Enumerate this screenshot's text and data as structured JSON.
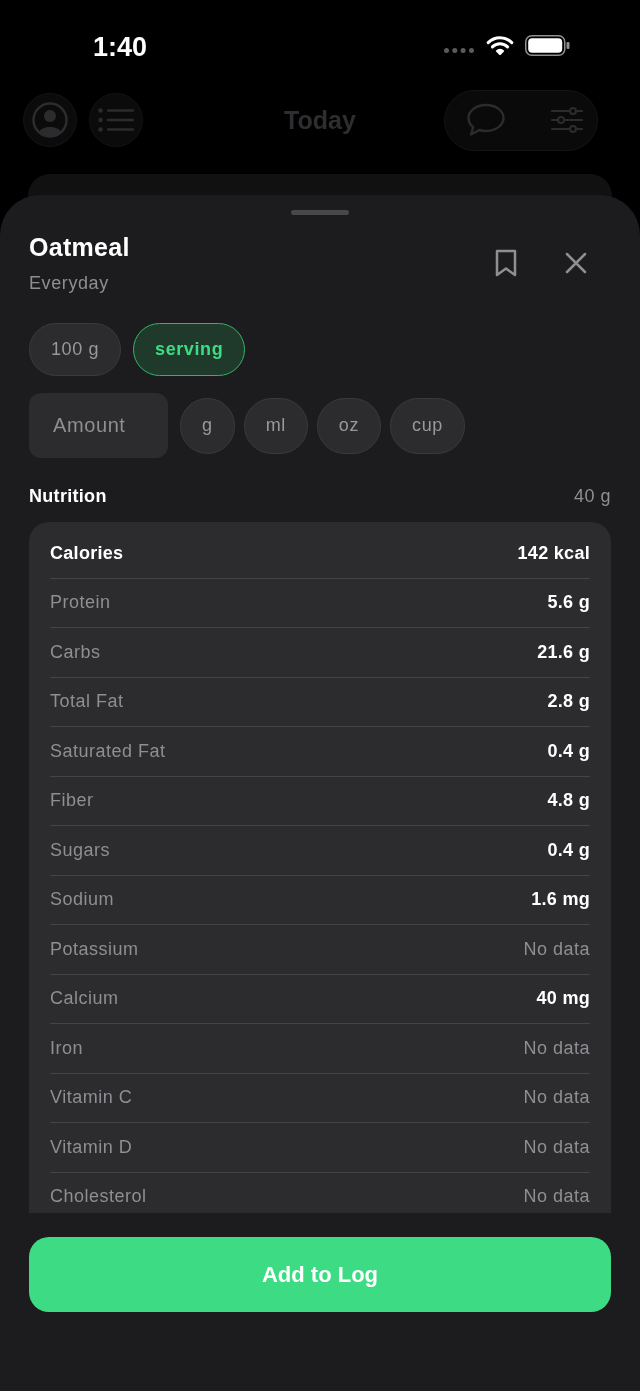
{
  "status_bar": {
    "time": "1:40"
  },
  "header": {
    "title": "Today"
  },
  "food": {
    "name": "Oatmeal",
    "brand": "Everyday"
  },
  "portion_options": [
    {
      "label": "100 g",
      "selected": false
    },
    {
      "label": "serving",
      "selected": true
    }
  ],
  "amount": {
    "placeholder": "Amount"
  },
  "units": [
    {
      "label": "g",
      "selected": false
    },
    {
      "label": "ml",
      "selected": false
    },
    {
      "label": "oz",
      "selected": false
    },
    {
      "label": "cup",
      "selected": false
    }
  ],
  "nutrition": {
    "title": "Nutrition",
    "serving_size": "40 g",
    "rows": [
      {
        "kind": "total",
        "name": "Calories",
        "value": "142 kcal"
      },
      {
        "kind": "nutrient",
        "name": "Protein",
        "value": "5.6 g"
      },
      {
        "kind": "nutrient",
        "name": "Carbs",
        "value": "21.6 g"
      },
      {
        "kind": "nutrient",
        "name": "Total Fat",
        "value": "2.8 g"
      },
      {
        "kind": "nutrient",
        "name": "Saturated Fat",
        "value": "0.4 g"
      },
      {
        "kind": "nutrient",
        "name": "Fiber",
        "value": "4.8 g"
      },
      {
        "kind": "nutrient",
        "name": "Sugars",
        "value": "0.4 g"
      },
      {
        "kind": "nutrient",
        "name": "Sodium",
        "value": "1.6 mg"
      },
      {
        "kind": "empty",
        "name": "Potassium",
        "value": "No data"
      },
      {
        "kind": "nutrient",
        "name": "Calcium",
        "value": "40 mg"
      },
      {
        "kind": "empty",
        "name": "Iron",
        "value": "No data"
      },
      {
        "kind": "empty",
        "name": "Vitamin C",
        "value": "No data"
      },
      {
        "kind": "empty",
        "name": "Vitamin D",
        "value": "No data"
      },
      {
        "kind": "empty",
        "name": "Cholesterol",
        "value": "No data"
      }
    ]
  },
  "primary_button": {
    "label": "Add to Log"
  }
}
